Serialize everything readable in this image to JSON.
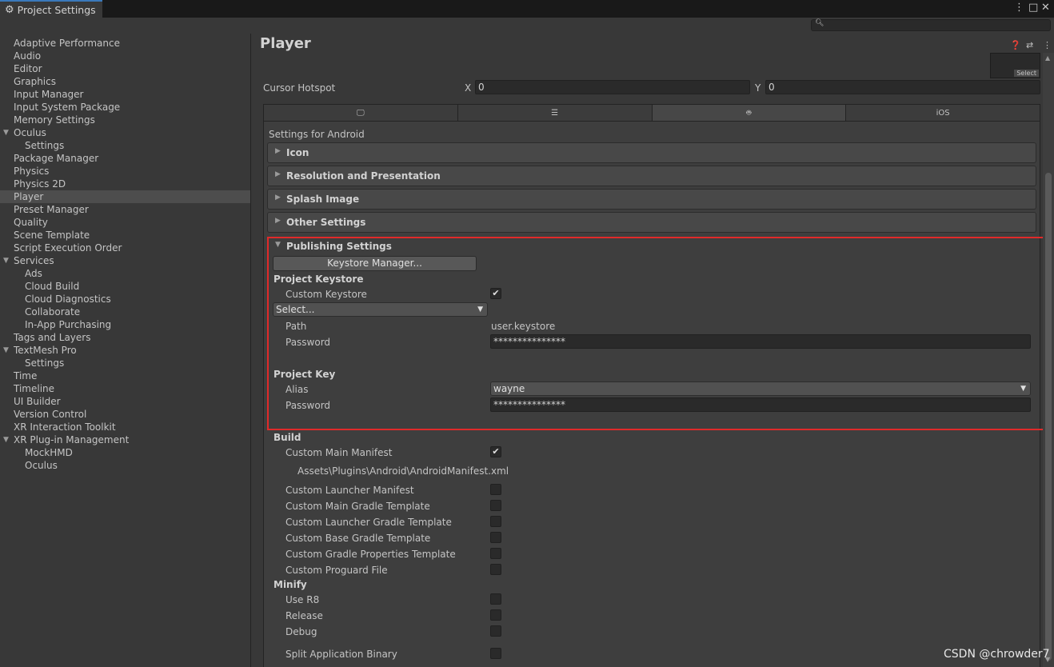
{
  "window": {
    "tab_title": "Project Settings",
    "controls": [
      "⋮",
      "□",
      "✕"
    ]
  },
  "sidebar": {
    "items": [
      {
        "label": "Adaptive Performance",
        "indent": 0
      },
      {
        "label": "Audio",
        "indent": 0
      },
      {
        "label": "Editor",
        "indent": 0
      },
      {
        "label": "Graphics",
        "indent": 0
      },
      {
        "label": "Input Manager",
        "indent": 0
      },
      {
        "label": "Input System Package",
        "indent": 0
      },
      {
        "label": "Memory Settings",
        "indent": 0
      },
      {
        "label": "Oculus",
        "indent": 0,
        "expanded": true
      },
      {
        "label": "Settings",
        "indent": 1
      },
      {
        "label": "Package Manager",
        "indent": 0
      },
      {
        "label": "Physics",
        "indent": 0
      },
      {
        "label": "Physics 2D",
        "indent": 0
      },
      {
        "label": "Player",
        "indent": 0,
        "selected": true
      },
      {
        "label": "Preset Manager",
        "indent": 0
      },
      {
        "label": "Quality",
        "indent": 0
      },
      {
        "label": "Scene Template",
        "indent": 0
      },
      {
        "label": "Script Execution Order",
        "indent": 0
      },
      {
        "label": "Services",
        "indent": 0,
        "expanded": true
      },
      {
        "label": "Ads",
        "indent": 1
      },
      {
        "label": "Cloud Build",
        "indent": 1
      },
      {
        "label": "Cloud Diagnostics",
        "indent": 1
      },
      {
        "label": "Collaborate",
        "indent": 1
      },
      {
        "label": "In-App Purchasing",
        "indent": 1
      },
      {
        "label": "Tags and Layers",
        "indent": 0
      },
      {
        "label": "TextMesh Pro",
        "indent": 0,
        "expanded": true
      },
      {
        "label": "Settings",
        "indent": 1
      },
      {
        "label": "Time",
        "indent": 0
      },
      {
        "label": "Timeline",
        "indent": 0
      },
      {
        "label": "UI Builder",
        "indent": 0
      },
      {
        "label": "Version Control",
        "indent": 0
      },
      {
        "label": "XR Interaction Toolkit",
        "indent": 0
      },
      {
        "label": "XR Plug-in Management",
        "indent": 0,
        "expanded": true
      },
      {
        "label": "MockHMD",
        "indent": 1
      },
      {
        "label": "Oculus",
        "indent": 1
      }
    ]
  },
  "main": {
    "title": "Player",
    "icon_select_label": "Select",
    "cursor_hotspot": {
      "label": "Cursor Hotspot",
      "x_label": "X",
      "x": "0",
      "y_label": "Y",
      "y": "0"
    },
    "platform_tabs": [
      {
        "name": "standalone",
        "icon": "monitor-icon",
        "label": ""
      },
      {
        "name": "server",
        "icon": "server-icon",
        "label": ""
      },
      {
        "name": "android",
        "icon": "android-icon",
        "label": "",
        "active": true
      },
      {
        "name": "ios",
        "icon": "",
        "label": "iOS"
      }
    ],
    "settings_for": "Settings for Android",
    "foldouts": [
      "Icon",
      "Resolution and Presentation",
      "Splash Image",
      "Other Settings"
    ],
    "publishing": {
      "title": "Publishing Settings",
      "keystore_manager_btn": "Keystore Manager...",
      "project_keystore_header": "Project Keystore",
      "custom_keystore_label": "Custom Keystore",
      "custom_keystore_checked": true,
      "keystore_select": "Select...",
      "path_label": "Path",
      "path_value": "user.keystore",
      "password_label": "Password",
      "password_value": "***************",
      "project_key_header": "Project Key",
      "alias_label": "Alias",
      "alias_value": "wayne",
      "key_password_label": "Password",
      "key_password_value": "***************"
    },
    "build": {
      "header": "Build",
      "custom_main_manifest": {
        "label": "Custom Main Manifest",
        "checked": true
      },
      "manifest_path": "Assets\\Plugins\\Android\\AndroidManifest.xml",
      "options": [
        {
          "label": "Custom Launcher Manifest",
          "checked": false
        },
        {
          "label": "Custom Main Gradle Template",
          "checked": false
        },
        {
          "label": "Custom Launcher Gradle Template",
          "checked": false
        },
        {
          "label": "Custom Base Gradle Template",
          "checked": false
        },
        {
          "label": "Custom Gradle Properties Template",
          "checked": false
        },
        {
          "label": "Custom Proguard File",
          "checked": false
        }
      ]
    },
    "minify": {
      "header": "Minify",
      "options": [
        {
          "label": "Use R8",
          "checked": false
        },
        {
          "label": "Release",
          "checked": false
        },
        {
          "label": "Debug",
          "checked": false
        }
      ]
    },
    "split_binary": {
      "label": "Split Application Binary",
      "checked": false
    }
  },
  "watermark": "CSDN @chrowder7",
  "colors": {
    "accent": "#3a79bb",
    "highlight_box": "#e02a2a",
    "selected_row": "#4d4d4d"
  }
}
